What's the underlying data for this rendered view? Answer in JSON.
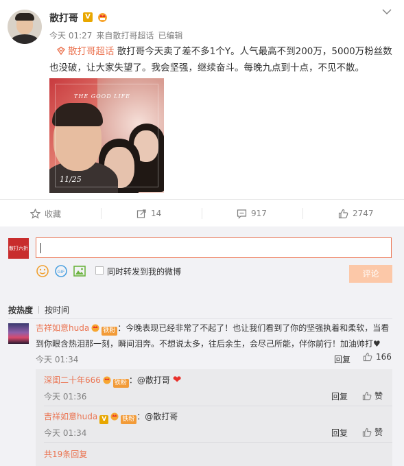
{
  "post": {
    "author": "散打哥",
    "verified_badge": "V",
    "time": "今天 01:27",
    "source_prefix": "来自",
    "source": "散打哥超话",
    "edited": "已编辑",
    "topic": "散打哥超话",
    "text": "散打哥今天卖了差不多1个Y。人气最高不到200万，5000万粉丝数也没破，让大家失望了。我会坚强，继续奋斗。每晚九点到十点，不见不散。",
    "photo": {
      "title": "THE GOOD LIFE",
      "date": "11/25"
    }
  },
  "actions": {
    "favorite": "收藏",
    "repost": "14",
    "comment": "917",
    "like": "2747"
  },
  "composer": {
    "avatar_text": "散打六折",
    "placeholder": "",
    "repost_label": "同时转发到我的微博",
    "submit": "评论"
  },
  "sort": {
    "hot": "按热度",
    "time": "按时间"
  },
  "comments": [
    {
      "user": "吉祥如意huda",
      "badge": "V",
      "fan": "铁粉",
      "text": "：今晚表现已经非常了不起了！也让我们看到了你的坚强执着和柔软，当看到你眼含热泪那一刻，瞬间泪奔。不想说太多，往后余生，会尽己所能，伴你前行！加油帅打♥",
      "time": "今天 01:34",
      "reply": "回复",
      "likes": "166"
    }
  ],
  "replies": [
    {
      "user": "深闺二十年666",
      "fan": "铁粉",
      "text": "：@散打哥",
      "emoji": "❤",
      "time": "今天 01:36",
      "reply": "回复",
      "like": "赞"
    },
    {
      "user": "吉祥如意huda",
      "badge": "V",
      "fan": "铁粉",
      "text": "：@散打哥",
      "time": "今天 01:34",
      "reply": "回复",
      "like": "赞"
    }
  ],
  "more_replies": "共19条回复",
  "colors": {
    "accent": "#eb7350",
    "vip": "#e8a700",
    "fan": "#f29b38"
  }
}
